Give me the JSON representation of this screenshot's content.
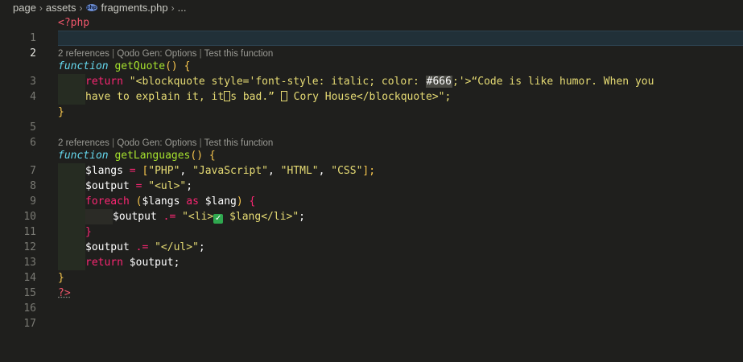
{
  "breadcrumb": {
    "items": [
      "page",
      "assets",
      "fragments.php",
      "..."
    ],
    "file_icon_text": "php"
  },
  "codelens": {
    "references": "2 references",
    "qodo": "Qodo Gen: Options",
    "test": "Test this function",
    "separator": "|"
  },
  "line_numbers": [
    "1",
    "2",
    "3",
    "4",
    "5",
    "6",
    "7",
    "8",
    "9",
    "10",
    "11",
    "12",
    "13",
    "14",
    "15",
    "16",
    "17"
  ],
  "code": {
    "l1": "<?php",
    "l3_kw": "function",
    "l3_name": "getQuote",
    "l3_parens": "()",
    "l3_brace": "{",
    "l4_return": "return",
    "l4_str1": "\"<blockquote style='font-style: italic; color: ",
    "l4_hex": "#666",
    "l4_str2": ";'>“Code is like humor. When you",
    "l4b_str1": "have to explain it, it",
    "l4b_str2": "s bad.” ",
    "l4b_str3": " Cory House</blockquote>\";",
    "l5": "}",
    "l7_kw": "function",
    "l7_name": "getLanguages",
    "l7_parens": "()",
    "l7_brace": "{",
    "l8_var": "$langs",
    "l8_eq": "=",
    "l8_open": "[",
    "l8_s1": "\"PHP\"",
    "l8_s2": "\"JavaScript\"",
    "l8_s3": "\"HTML\"",
    "l8_s4": "\"CSS\"",
    "l8_close": "];",
    "l8_comma": ",",
    "l9_var": "$output",
    "l9_eq": "=",
    "l9_str": "\"<ul>\"",
    "l9_end": ";",
    "l10_kw": "foreach",
    "l10_open": "(",
    "l10_var1": "$langs",
    "l10_as": "as",
    "l10_var2": "$lang",
    "l10_close": ")",
    "l10_brace": "{",
    "l11_var": "$output",
    "l11_op": ".=",
    "l11_str1": "\"<li>",
    "l11_check": "✓",
    "l11_str2": " $lang</li>\"",
    "l11_end": ";",
    "l12": "}",
    "l13_var": "$output",
    "l13_op": ".=",
    "l13_str": "\"</ul>\"",
    "l13_end": ";",
    "l14_return": "return",
    "l14_var": "$output",
    "l14_end": ";",
    "l15": "}",
    "l16": "?>"
  },
  "colors": {
    "background": "#1f1f1d",
    "keyword": "#f92672",
    "function_keyword": "#66d9ef",
    "function_name": "#a6e22e",
    "string": "#e6db74",
    "active_line": "#213038"
  }
}
